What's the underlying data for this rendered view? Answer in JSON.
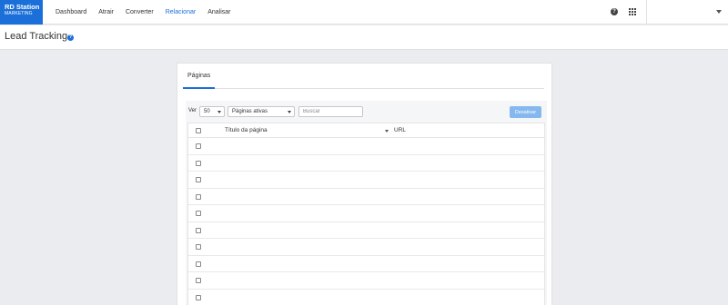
{
  "brand": {
    "name": "RD Station",
    "subtitle": "MARKETING",
    "color": "#1b6fd8"
  },
  "nav": {
    "items": [
      {
        "label": "Dashboard",
        "active": false
      },
      {
        "label": "Atrair",
        "active": false
      },
      {
        "label": "Converter",
        "active": false
      },
      {
        "label": "Relacionar",
        "active": true
      },
      {
        "label": "Analisar",
        "active": false
      }
    ]
  },
  "header_icons": {
    "help": "question-circle-icon",
    "apps": "apps-grid-icon",
    "user_menu": "chevron-down-icon"
  },
  "page": {
    "title": "Lead Tracking",
    "title_help_icon": "question-circle-icon"
  },
  "tabs": [
    {
      "label": "Páginas",
      "active": true
    }
  ],
  "filters": {
    "ver_label": "Ver",
    "limit_value": "50",
    "status_value": "Páginas ativas",
    "search_placeholder": "Buscar",
    "deactivate_label": "Desativar"
  },
  "table": {
    "columns": [
      "Título da página",
      "URL"
    ],
    "sort_column": "URL",
    "rows": [
      {
        "title": "",
        "url": ""
      },
      {
        "title": "",
        "url": ""
      },
      {
        "title": "",
        "url": ""
      },
      {
        "title": "",
        "url": ""
      },
      {
        "title": "",
        "url": ""
      },
      {
        "title": "",
        "url": ""
      },
      {
        "title": "",
        "url": ""
      },
      {
        "title": "",
        "url": ""
      },
      {
        "title": "",
        "url": ""
      },
      {
        "title": "",
        "url": ""
      }
    ]
  },
  "colors": {
    "accent": "#1b6fd8",
    "button_disabled": "#85b8ee",
    "background": "#ebecf0"
  }
}
